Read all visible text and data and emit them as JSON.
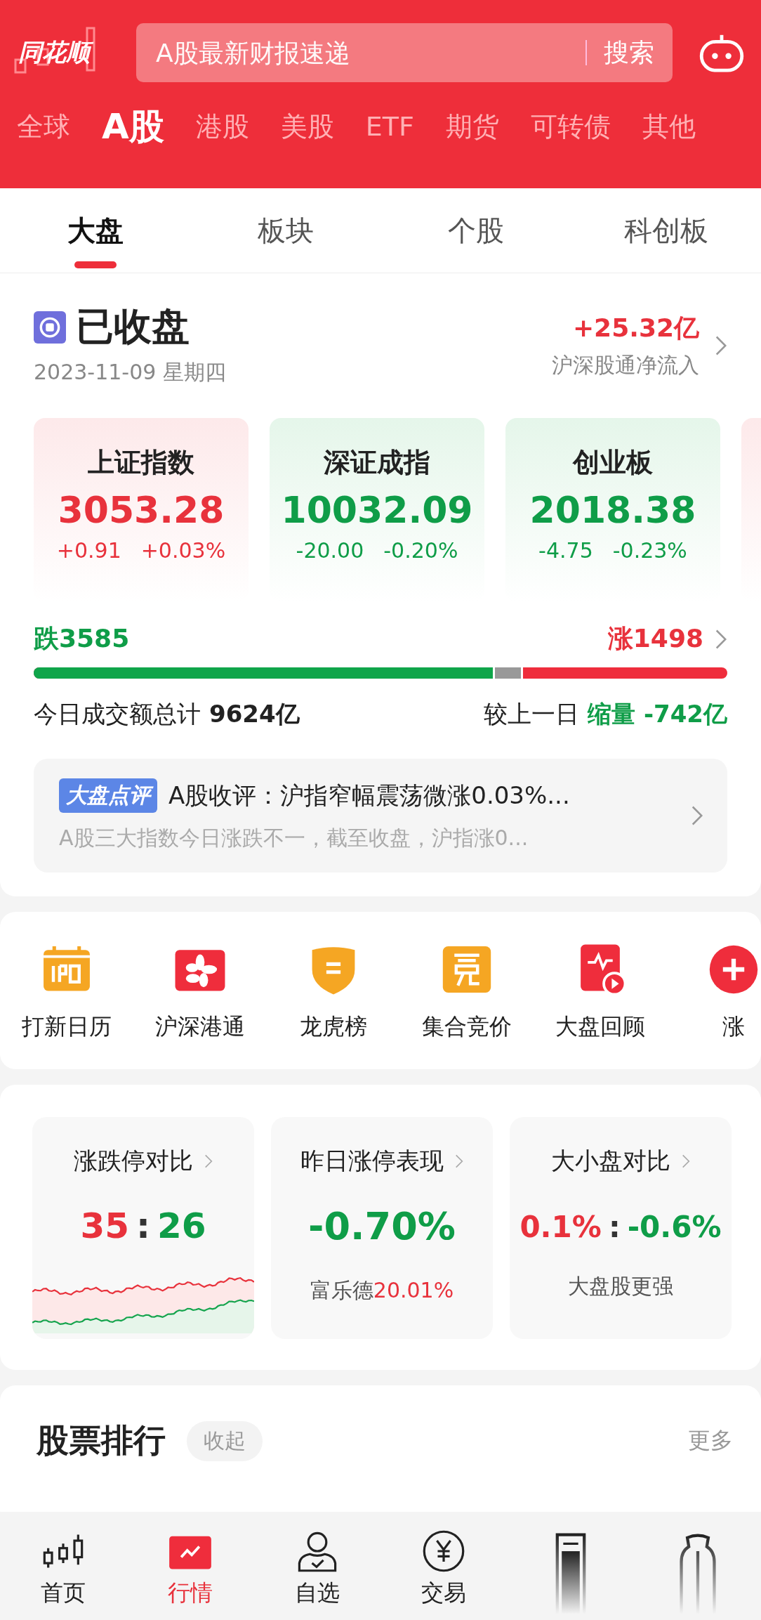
{
  "header": {
    "logo": "同花顺",
    "search": {
      "placeholder": "A股最新财报速递",
      "button": "搜索"
    }
  },
  "market_tabs": [
    {
      "label": "全球",
      "selected": false
    },
    {
      "label": "A股",
      "selected": true
    },
    {
      "label": "港股",
      "selected": false
    },
    {
      "label": "美股",
      "selected": false
    },
    {
      "label": "ETF",
      "selected": false
    },
    {
      "label": "期货",
      "selected": false
    },
    {
      "label": "可转债",
      "selected": false
    },
    {
      "label": "其他",
      "selected": false
    }
  ],
  "sub_tabs": [
    {
      "label": "大盘",
      "selected": true
    },
    {
      "label": "板块",
      "selected": false
    },
    {
      "label": "个股",
      "selected": false
    },
    {
      "label": "科创板",
      "selected": false
    }
  ],
  "status": {
    "title": "已收盘",
    "date": "2023-11-09 星期四",
    "flow_value": "+25.32亿",
    "flow_label": "沪深股通净流入"
  },
  "indices": [
    {
      "name": "上证指数",
      "value": "3053.28",
      "change": "+0.91",
      "percent": "+0.03%",
      "kind": "up"
    },
    {
      "name": "深证成指",
      "value": "10032.09",
      "change": "-20.00",
      "percent": "-0.20%",
      "kind": "down"
    },
    {
      "name": "创业板",
      "value": "2018.38",
      "change": "-4.75",
      "percent": "-0.23%",
      "kind": "down"
    }
  ],
  "breadth": {
    "fall": "跌3585",
    "rise": "涨1498",
    "not_rising": {
      "level": 0.705
    },
    "falling": {
      "level": 0.665
    }
  },
  "turnover": {
    "label": "今日成交额总计",
    "value": "9624亿",
    "compare_label": "较上一日",
    "compare_kind": "缩量",
    "compare_value": "-742亿"
  },
  "commentary": {
    "badge": "大盘点评",
    "title": "A股收评：沪指窄幅震荡微涨0.03%...",
    "summary": "A股三大指数今日涨跌不一，截至收盘，沪指涨0..."
  },
  "shortcuts": [
    {
      "label": "打新日历",
      "kind": "ipo"
    },
    {
      "label": "沪深港通",
      "kind": "flower"
    },
    {
      "label": "龙虎榜",
      "kind": "shield"
    },
    {
      "label": "集合竞价",
      "kind": "bid"
    },
    {
      "label": "大盘回顾",
      "kind": "review"
    },
    {
      "label": "涨",
      "kind": "limit"
    }
  ],
  "stats": [
    {
      "kind": "ratio_chart",
      "title": "涨跌停对比",
      "up": "35",
      "separator": ":",
      "down": "26"
    },
    {
      "kind": "value",
      "title": "昨日涨停表现",
      "value": "-0.70%",
      "note": "富乐德",
      "note_value": "20.01%"
    },
    {
      "kind": "ratio_text",
      "title": "大小盘对比",
      "up": "0.1%",
      "separator": ":",
      "down": "-0.6%",
      "note": "大盘股更强"
    }
  ],
  "ranking": {
    "title": "股票排行",
    "toggle": "收起",
    "more": "更多"
  },
  "nav": [
    {
      "label": "首页",
      "kind": "candles",
      "selected": false
    },
    {
      "label": "行情",
      "kind": "chart",
      "selected": true
    },
    {
      "label": "自选",
      "kind": "person",
      "selected": false
    },
    {
      "label": "交易",
      "kind": "yen",
      "selected": false
    },
    {
      "kind": "block",
      "selected": false
    },
    {
      "kind": "bottle",
      "selected": false
    }
  ]
}
